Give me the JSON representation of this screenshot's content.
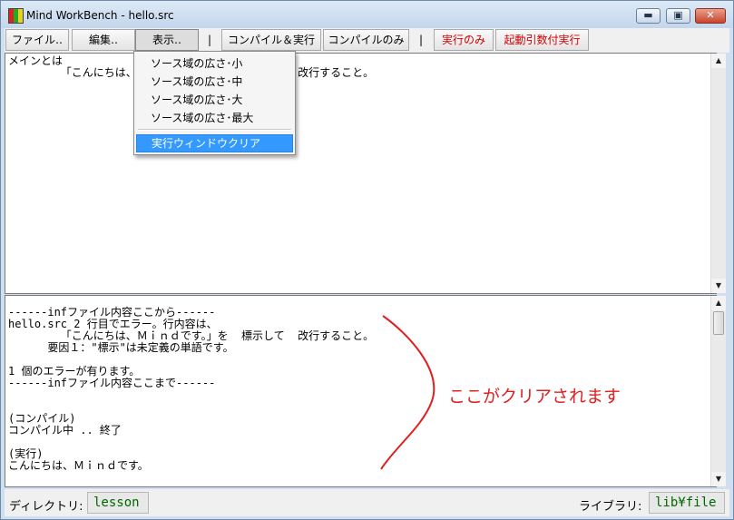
{
  "window": {
    "title": "Mind WorkBench - hello.src",
    "minimize_glyph": "▬",
    "maximize_glyph": "▣",
    "close_glyph": "✕"
  },
  "toolbar": {
    "file": "ファイル‥",
    "edit": "編集‥",
    "view": "表示‥",
    "sep1": "|",
    "compile_run": "コンパイル＆実行",
    "compile_only": "コンパイルのみ",
    "sep2": "|",
    "run_only": "実行のみ",
    "run_with_args": "起動引数付実行"
  },
  "view_menu": {
    "items": [
      "ソース域の広さ･小",
      "ソース域の広さ･中",
      "ソース域の広さ･大",
      "ソース域の広さ･最大"
    ],
    "clear_exec": "実行ウィンドウクリア"
  },
  "source": {
    "text": "メインとは\n        「こんにちは、Ｍｉｎｄです。」を  表示して  改行すること。"
  },
  "output": {
    "text": "------infファイル内容ここから------\nhello.src 2 行目でエラー。行内容は、\n        「こんにちは、Ｍｉｎｄです。」を  標示して  改行すること。\n      要因１：\"標示\"は未定義の単語です。\n\n1 個のエラーが有ります。\n------infファイル内容ここまで------\n\n\n(コンパイル)\nコンパイル中 .. 終了\n\n(実行)\nこんにちは、Ｍｉｎｄです。"
  },
  "annotation": {
    "text": "ここがクリアされます",
    "color": "#e02020"
  },
  "status": {
    "dir_label": "ディレクトリ:",
    "dir_value": "lesson",
    "lib_label": "ライブラリ:",
    "lib_value": "lib¥file"
  },
  "scroll": {
    "up": "▲",
    "down": "▼"
  }
}
